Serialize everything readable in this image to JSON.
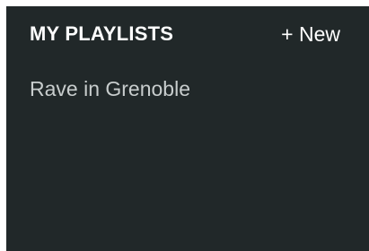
{
  "header": {
    "title": "MY PLAYLISTS",
    "new_button_label": "+ New"
  },
  "playlists": [
    {
      "label": "Rave in Grenoble"
    }
  ],
  "colors": {
    "panel_background": "#212829",
    "title_text": "#ffffff",
    "item_text": "#c8cdcd",
    "page_background": "#ffffff"
  }
}
